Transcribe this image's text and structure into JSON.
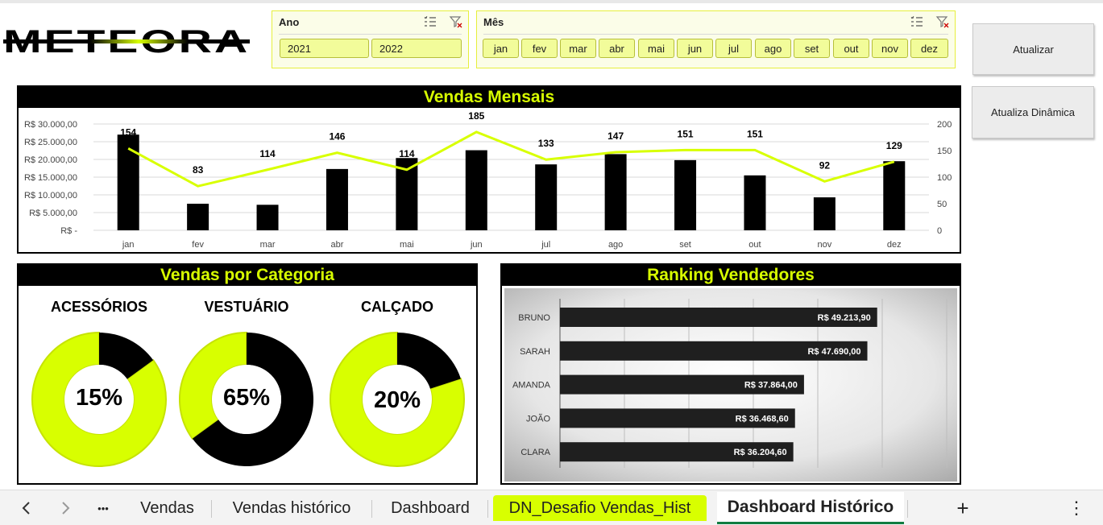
{
  "logo": {
    "text": "METEORA"
  },
  "slicers": {
    "year": {
      "title": "Ano",
      "options": [
        "2021",
        "2022"
      ]
    },
    "month": {
      "title": "Mês",
      "options": [
        "jan",
        "fev",
        "mar",
        "abr",
        "mai",
        "jun",
        "jul",
        "ago",
        "set",
        "out",
        "nov",
        "dez"
      ]
    }
  },
  "buttons": {
    "refresh": "Atualizar",
    "refresh_dynamic": "Atualiza Dinâmica"
  },
  "monthly": {
    "title": "Vendas Mensais",
    "y_ticks_left": [
      "R$ 30.000,00",
      "R$ 25.000,00",
      "R$ 20.000,00",
      "R$ 15.000,00",
      "R$ 10.000,00",
      "R$ 5.000,00",
      "R$ -"
    ],
    "y_ticks_right": [
      "200",
      "150",
      "100",
      "50",
      "0"
    ]
  },
  "category": {
    "title": "Vendas por Categoria",
    "items": [
      {
        "label": "ACESSÓRIOS",
        "pct": "15%",
        "value": 0.15
      },
      {
        "label": "VESTUÁRIO",
        "pct": "65%",
        "value": 0.65
      },
      {
        "label": "CALÇADO",
        "pct": "20%",
        "value": 0.2
      }
    ]
  },
  "ranking": {
    "title": "Ranking Vendedores",
    "sellers": [
      {
        "name": "BRUNO",
        "label": "R$ 49.213,90",
        "value": 49213.9
      },
      {
        "name": "SARAH",
        "label": "R$ 47.690,00",
        "value": 47690.0
      },
      {
        "name": "AMANDA",
        "label": "R$ 37.864,00",
        "value": 37864.0
      },
      {
        "name": "JOÃO",
        "label": "R$ 36.468,60",
        "value": 36468.6
      },
      {
        "name": "CLARA",
        "label": "R$ 36.204,60",
        "value": 36204.6
      }
    ]
  },
  "chart_data": {
    "type": "bar",
    "title": "Vendas Mensais",
    "categories": [
      "jan",
      "fev",
      "mar",
      "abr",
      "mai",
      "jun",
      "jul",
      "ago",
      "set",
      "out",
      "nov",
      "dez"
    ],
    "ylim": [
      0,
      30000
    ],
    "y2lim": [
      0,
      200
    ],
    "series": [
      {
        "type": "bar",
        "axis": "left",
        "values": [
          27000,
          7500,
          7200,
          17300,
          20400,
          22600,
          18600,
          21500,
          19800,
          15500,
          9300,
          19500
        ]
      },
      {
        "type": "line",
        "axis": "right",
        "values": [
          154,
          83,
          114,
          146,
          114,
          185,
          133,
          147,
          151,
          151,
          92,
          129
        ],
        "data_labels": [
          "154",
          "83",
          "114",
          "146",
          "114",
          "185",
          "133",
          "147",
          "151",
          "151",
          "92",
          "129"
        ]
      }
    ],
    "colors": {
      "bar": "#000000",
      "line": "#d8ff00",
      "accent": "#d8ff00"
    }
  },
  "tabs": {
    "nav_prev": "‹",
    "nav_next": "›",
    "more": "•••",
    "items": [
      "Vendas",
      "Vendas histórico",
      "Dashboard",
      "DN_Desafio Vendas_Hist",
      "Dashboard Histórico"
    ],
    "add": "+",
    "options": "⋮"
  }
}
